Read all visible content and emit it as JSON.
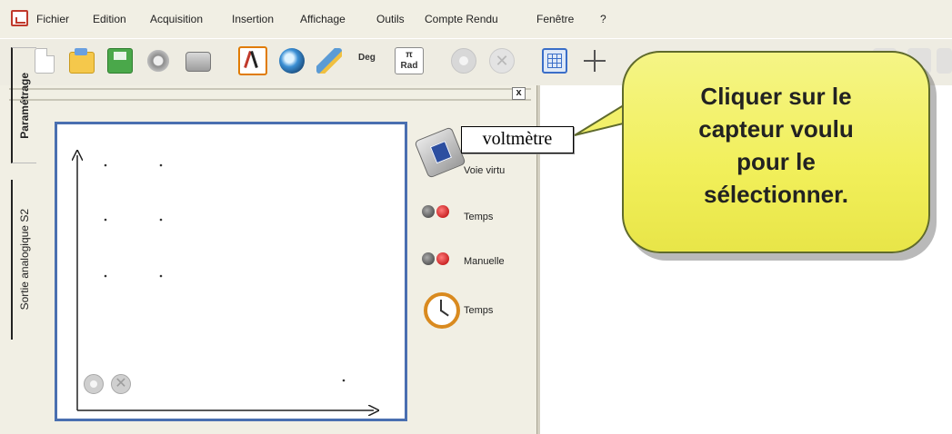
{
  "menubar": {
    "items": [
      "Fichier",
      "Edition",
      "Acquisition",
      "Insertion",
      "Affichage",
      "Outils",
      "Compte Rendu",
      "Fenêtre",
      "?"
    ]
  },
  "toolbar": {
    "deg_label": "Deg",
    "rad_symbol": "π",
    "rad_label": "Rad",
    "icons": [
      "new-document-icon",
      "open-folder-icon",
      "save-icon",
      "settings-icon",
      "print-icon",
      "probe-icon",
      "webcam-icon",
      "pen-icon",
      "deg-button",
      "rad-button",
      "record-disabled-icon",
      "stop-disabled-icon",
      "grid-icon",
      "crosshair-icon"
    ]
  },
  "panel": {
    "close_label": "x",
    "tabs": [
      "Paramétrage",
      "Sortie analogique S2"
    ]
  },
  "sensors": [
    {
      "label": "Voie virtu",
      "icon": "voltmeter-icon"
    },
    {
      "label": "Temps",
      "icon": "channel-dots-icon"
    },
    {
      "label": "Manuelle",
      "icon": "channel-dots-icon"
    },
    {
      "label": "Temps",
      "icon": "stopwatch-icon"
    }
  ],
  "tooltip": {
    "text": "voltmètre"
  },
  "callout": {
    "text": "Cliquer sur le\ncapteur voulu\npour le\nsélectionner."
  },
  "colors": {
    "callout_fill": "#f2f06a",
    "graph_border": "#4a6fb0",
    "window_bg": "#f1efe4"
  }
}
